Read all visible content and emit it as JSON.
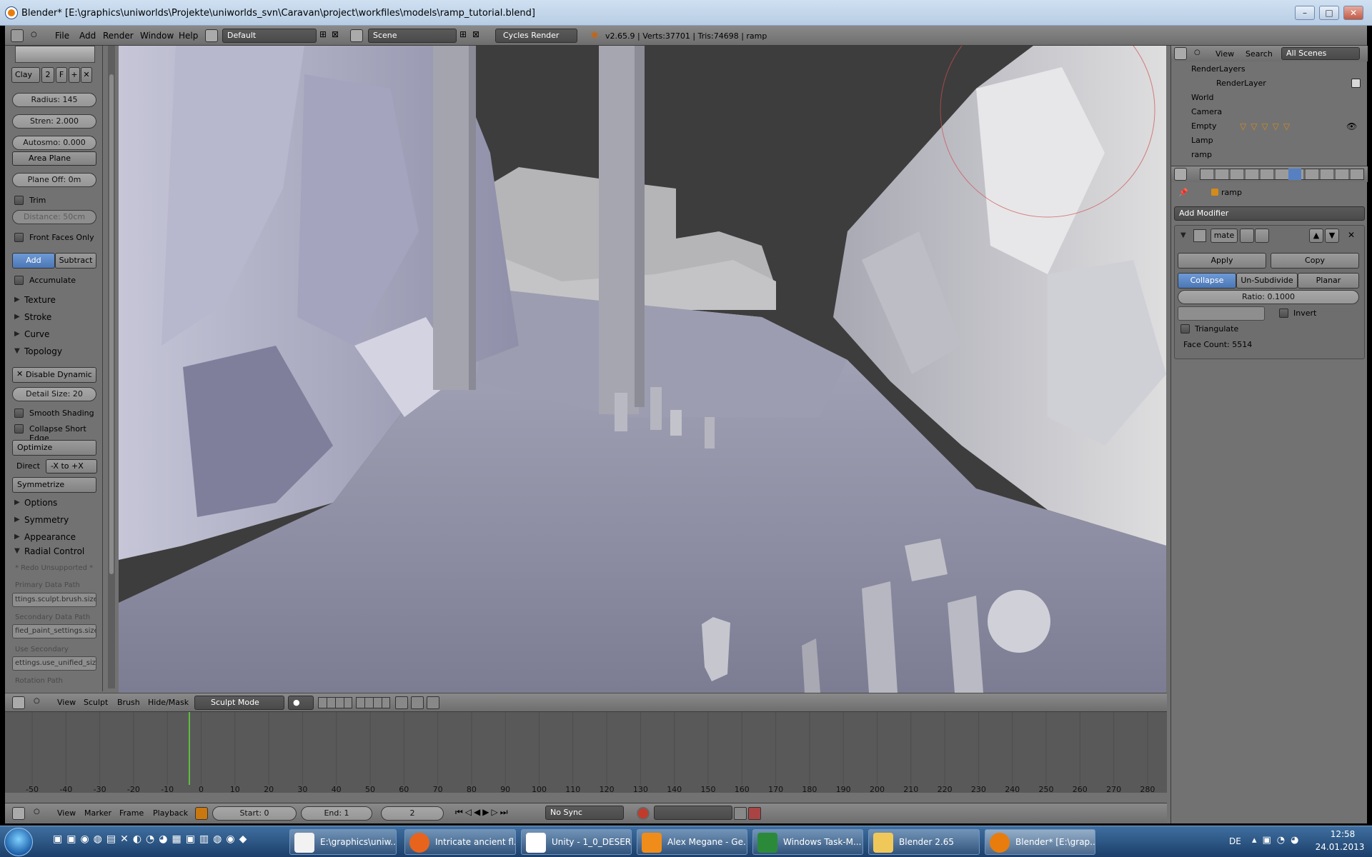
{
  "window": {
    "title": "Blender* [E:\\graphics\\uniworlds\\Projekte\\uniworlds_svn\\Caravan\\project\\workfiles\\models\\ramp_tutorial.blend]"
  },
  "menubar": {
    "file": "File",
    "add": "Add",
    "render": "Render",
    "window": "Window",
    "help": "Help",
    "layout": "Default",
    "scene": "Scene",
    "engine": "Cycles Render",
    "stats": "v2.65.9 | Verts:37701 | Tris:74698 | ramp"
  },
  "toolshelf": {
    "brush_name": "Clay",
    "brush_users": "2",
    "brush_fake": "F",
    "radius": "Radius: 145",
    "strength": "Stren: 2.000",
    "autosmooth": "Autosmo: 0.000",
    "area_plane": "Area Plane",
    "plane_offset": "Plane Off: 0m",
    "trim": "Trim",
    "distance": "Distance: 50cm",
    "front_faces": "Front Faces Only",
    "add": "Add",
    "subtract": "Subtract",
    "accumulate": "Accumulate",
    "texture": "Texture",
    "stroke": "Stroke",
    "curve": "Curve",
    "topology": "Topology",
    "disable_dynamic": "Disable Dynamic",
    "detail_size": "Detail Size: 20",
    "smooth_shading": "Smooth Shading",
    "collapse_short": "Collapse Short Edge",
    "optimize": "Optimize",
    "direct_label": "Direct",
    "direct_value": "-X to +X",
    "symmetrize": "Symmetrize",
    "options": "Options",
    "symmetry": "Symmetry",
    "appearance": "Appearance",
    "radial_control": "Radial Control",
    "redo_unsupported": "* Redo Unsupported *",
    "primary_label": "Primary Data Path",
    "primary_value": "ttings.sculpt.brush.size",
    "secondary_label": "Secondary Data Path",
    "secondary_value": "fied_paint_settings.size",
    "use_secondary_label": "Use Secondary",
    "use_secondary_value": "ettings.use_unified_size",
    "rotation_label": "Rotation Path"
  },
  "viewport_header": {
    "view": "View",
    "sculpt": "Sculpt",
    "brush": "Brush",
    "hidemask": "Hide/Mask",
    "mode": "Sculpt Mode"
  },
  "timeline": {
    "ticks": [
      "-50",
      "-40",
      "-30",
      "-20",
      "-10",
      "0",
      "10",
      "20",
      "30",
      "40",
      "50",
      "60",
      "70",
      "80",
      "90",
      "100",
      "110",
      "120",
      "130",
      "140",
      "150",
      "160",
      "170",
      "180",
      "190",
      "200",
      "210",
      "220",
      "230",
      "240",
      "250",
      "260",
      "270",
      "280"
    ],
    "current_frame": 1
  },
  "timeline_footer": {
    "view": "View",
    "marker": "Marker",
    "frame": "Frame",
    "playback": "Playback",
    "start": "Start: 0",
    "end": "End: 1",
    "current": "2",
    "sync": "No Sync"
  },
  "outliner": {
    "view": "View",
    "search": "Search",
    "scenes": "All Scenes",
    "items": [
      "RenderLayers",
      "RenderLayer",
      "World",
      "Camera",
      "Empty",
      "Lamp",
      "ramp"
    ]
  },
  "properties": {
    "object": "ramp",
    "add_modifier": "Add Modifier",
    "modifier_name": "mate",
    "apply": "Apply",
    "copy": "Copy",
    "collapse": "Collapse",
    "unsubdivide": "Un-Subdivide",
    "planar": "Planar",
    "ratio": "Ratio: 0.1000",
    "invert": "Invert",
    "triangulate": "Triangulate",
    "face_count": "Face Count: 5514"
  },
  "taskbar": {
    "tasks": [
      "E:\\graphics\\uniw...",
      "Intricate ancient fl...",
      "Unity - 1_0_DESER...",
      "Alex Megane - Ge...",
      "Windows Task-M...",
      "Blender 2.65",
      "Blender* [E:\\grap..."
    ],
    "lang": "DE",
    "time": "12:58",
    "date": "24.01.2013"
  },
  "colors": {
    "accent": "#5680c2",
    "panel": "#727272",
    "viewport_sky": "#3d3d3d",
    "rock": "#c9c9d3"
  }
}
